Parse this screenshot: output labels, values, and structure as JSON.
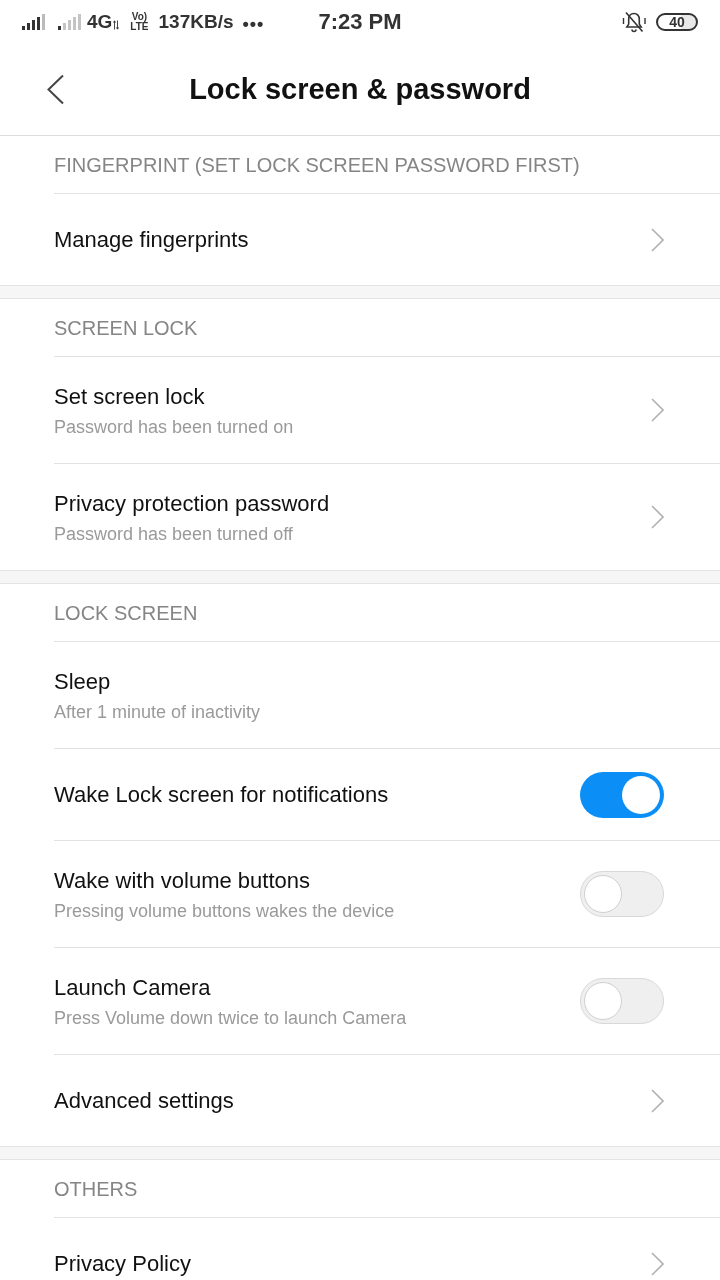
{
  "status_bar": {
    "network": "4G",
    "volte_top": "Vo)",
    "volte_bottom": "LTE",
    "speed": "137KB/s",
    "more": "•••",
    "time": "7:23 PM",
    "battery": "40"
  },
  "header": {
    "title": "Lock screen & password"
  },
  "sections": [
    {
      "header": "FINGERPRINT (SET LOCK SCREEN PASSWORD FIRST)",
      "items": [
        {
          "kind": "link",
          "title": "Manage fingerprints"
        }
      ]
    },
    {
      "header": "SCREEN LOCK",
      "items": [
        {
          "kind": "link",
          "title": "Set screen lock",
          "subtitle": "Password has been turned on"
        },
        {
          "kind": "link",
          "title": "Privacy protection password",
          "subtitle": "Password has been turned off"
        }
      ]
    },
    {
      "header": "LOCK SCREEN",
      "items": [
        {
          "kind": "plain",
          "title": "Sleep",
          "subtitle": "After 1 minute of inactivity"
        },
        {
          "kind": "switch",
          "title": "Wake Lock screen for notifications",
          "on": true
        },
        {
          "kind": "switch",
          "title": "Wake with volume buttons",
          "subtitle": "Pressing volume buttons wakes the device",
          "on": false
        },
        {
          "kind": "switch",
          "title": "Launch Camera",
          "subtitle": "Press Volume down twice to launch Camera",
          "on": false
        },
        {
          "kind": "link",
          "title": "Advanced settings"
        }
      ]
    },
    {
      "header": "OTHERS",
      "items": [
        {
          "kind": "link",
          "title": "Privacy Policy"
        }
      ]
    }
  ]
}
